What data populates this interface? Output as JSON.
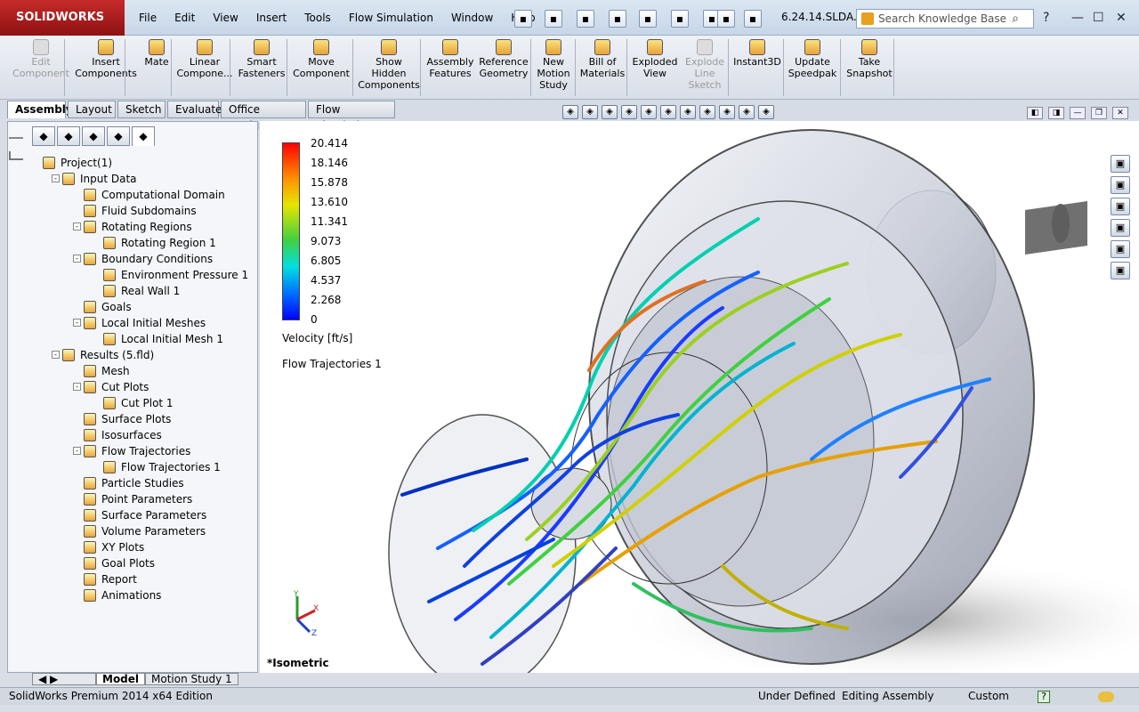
{
  "app": {
    "logo": "SOLIDWORKS",
    "filename": "6.24.14.SLDA...",
    "search_placeholder": "Search Knowledge Base",
    "search_icon": "search-icon"
  },
  "menu": [
    "File",
    "Edit",
    "View",
    "Insert",
    "Tools",
    "Flow Simulation",
    "Window",
    "Help"
  ],
  "quick_access": [
    "new-document-icon",
    "open-icon",
    "save-icon",
    "print-icon",
    "undo-icon",
    "select-icon",
    "rebuild-icon",
    "file-properties-icon",
    "options-icon"
  ],
  "window_controls": {
    "help": "?",
    "min": "—",
    "max": "☐",
    "close": "✕"
  },
  "commands": [
    {
      "label": "Edit\nComponent",
      "disabled": true
    },
    {
      "label": "Insert\nComponents",
      "disabled": false
    },
    {
      "label": "Mate",
      "disabled": false
    },
    {
      "label": "Linear\nCompone...",
      "disabled": false
    },
    {
      "label": "Smart\nFasteners",
      "disabled": false
    },
    {
      "label": "Move\nComponent",
      "disabled": false
    },
    {
      "label": "Show\nHidden\nComponents",
      "disabled": false
    },
    {
      "label": "Assembly\nFeatures",
      "disabled": false
    },
    {
      "label": "Reference\nGeometry",
      "disabled": false
    },
    {
      "label": "New\nMotion\nStudy",
      "disabled": false
    },
    {
      "label": "Bill of\nMaterials",
      "disabled": false
    },
    {
      "label": "Exploded\nView",
      "disabled": false
    },
    {
      "label": "Explode\nLine\nSketch",
      "disabled": true
    },
    {
      "label": "Instant3D",
      "disabled": false
    },
    {
      "label": "Update\nSpeedpak",
      "disabled": false
    },
    {
      "label": "Take\nSnapshot",
      "disabled": false
    }
  ],
  "tabs": [
    "Assembly",
    "Layout",
    "Sketch",
    "Evaluate",
    "Office Products",
    "Flow Simulation"
  ],
  "active_tab": "Assembly",
  "fm_tabs": [
    "feature-manager-icon",
    "property-manager-icon",
    "configuration-manager-icon",
    "display-manager-icon",
    "flow-simulation-analysis-icon"
  ],
  "tree": [
    {
      "label": "Project(1)",
      "level": 0,
      "exp": null
    },
    {
      "label": "Input Data",
      "level": 1,
      "exp": "-"
    },
    {
      "label": "Computational Domain",
      "level": 2,
      "exp": null
    },
    {
      "label": "Fluid Subdomains",
      "level": 2,
      "exp": null
    },
    {
      "label": "Rotating Regions",
      "level": 2,
      "exp": "-"
    },
    {
      "label": "Rotating Region 1",
      "level": 3,
      "exp": null
    },
    {
      "label": "Boundary Conditions",
      "level": 2,
      "exp": "-"
    },
    {
      "label": "Environment Pressure 1",
      "level": 3,
      "exp": null
    },
    {
      "label": "Real Wall 1",
      "level": 3,
      "exp": null
    },
    {
      "label": "Goals",
      "level": 2,
      "exp": null
    },
    {
      "label": "Local Initial Meshes",
      "level": 2,
      "exp": "-"
    },
    {
      "label": "Local Initial Mesh 1",
      "level": 3,
      "exp": null
    },
    {
      "label": "Results (5.fld)",
      "level": 1,
      "exp": "-"
    },
    {
      "label": "Mesh",
      "level": 2,
      "exp": null
    },
    {
      "label": "Cut Plots",
      "level": 2,
      "exp": "-"
    },
    {
      "label": "Cut Plot 1",
      "level": 3,
      "exp": null
    },
    {
      "label": "Surface Plots",
      "level": 2,
      "exp": null
    },
    {
      "label": "Isosurfaces",
      "level": 2,
      "exp": null
    },
    {
      "label": "Flow Trajectories",
      "level": 2,
      "exp": "-"
    },
    {
      "label": "Flow Trajectories 1",
      "level": 3,
      "exp": null
    },
    {
      "label": "Particle Studies",
      "level": 2,
      "exp": null
    },
    {
      "label": "Point Parameters",
      "level": 2,
      "exp": null
    },
    {
      "label": "Surface Parameters",
      "level": 2,
      "exp": null
    },
    {
      "label": "Volume Parameters",
      "level": 2,
      "exp": null
    },
    {
      "label": "XY Plots",
      "level": 2,
      "exp": null
    },
    {
      "label": "Goal Plots",
      "level": 2,
      "exp": null
    },
    {
      "label": "Report",
      "level": 2,
      "exp": null
    },
    {
      "label": "Animations",
      "level": 2,
      "exp": null
    }
  ],
  "bottom_tabs": [
    "Model",
    "Motion Study 1"
  ],
  "legend": {
    "values": [
      "20.414",
      "18.146",
      "15.878",
      "13.610",
      "11.341",
      "9.073",
      "6.805",
      "4.537",
      "2.268",
      "0"
    ],
    "title": "Velocity [ft/s]"
  },
  "trajectory_label": "Flow Trajectories 1",
  "view_label": "*Isometric",
  "status": {
    "product": "SolidWorks Premium 2014 x64 Edition",
    "state": "Under Defined",
    "mode": "Editing Assembly",
    "units": "Custom",
    "help": "?"
  },
  "triad": {
    "x": "X",
    "y": "Y",
    "z": "Z"
  },
  "heads_up": [
    "zoom-to-fit-icon",
    "zoom-area-icon",
    "previous-view-icon",
    "section-view-icon",
    "dynamic-annotation-icon",
    "view-orientation-icon",
    "display-style-icon",
    "hide-show-icon",
    "edit-appearance-icon",
    "apply-scene-icon",
    "view-settings-icon"
  ],
  "task_pane": [
    "home-icon",
    "design-library-icon",
    "file-explorer-icon",
    "view-palette-icon",
    "appearances-icon",
    "custom-properties-icon"
  ]
}
